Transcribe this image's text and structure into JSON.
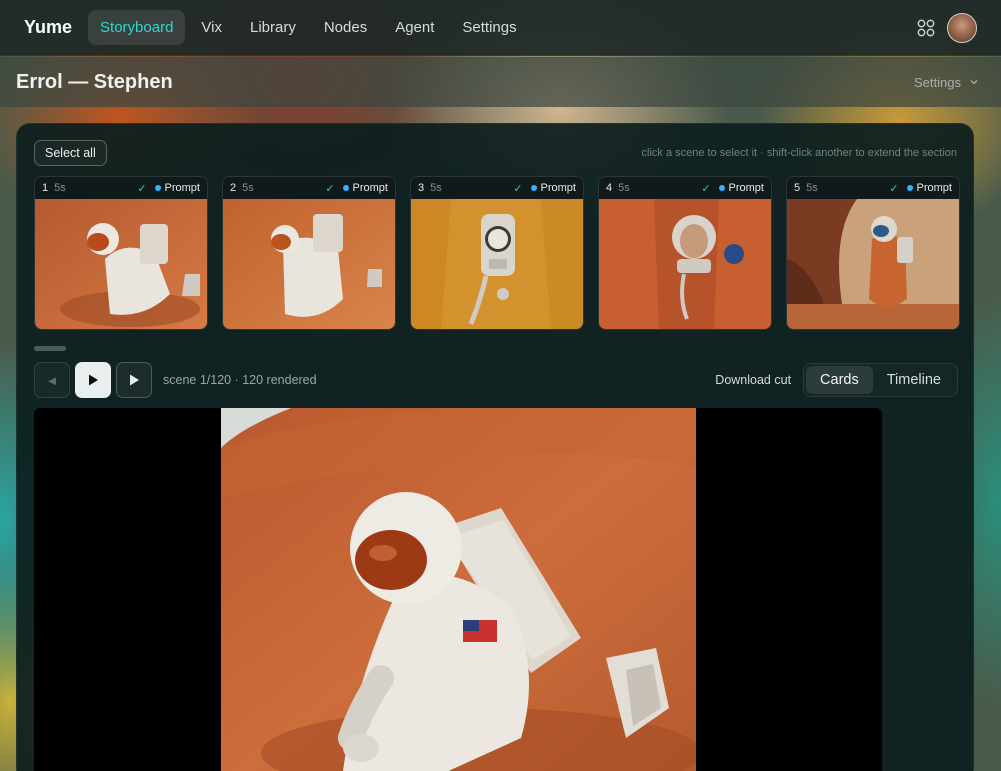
{
  "nav": {
    "brand": "Yume",
    "items": [
      {
        "label": "Storyboard",
        "active": true
      },
      {
        "label": "Vix",
        "active": false
      },
      {
        "label": "Library",
        "active": false
      },
      {
        "label": "Nodes",
        "active": false
      },
      {
        "label": "Agent",
        "active": false
      },
      {
        "label": "Settings",
        "active": false
      }
    ],
    "icons": [
      "apps-grid-icon",
      "user-avatar"
    ]
  },
  "subheader": {
    "title": "Errol — Stephen",
    "settings_label": "Settings"
  },
  "storyboard": {
    "select_all_label": "Select all",
    "hint": "click a scene to select it · shift-click another to extend the section",
    "scenes": [
      {
        "number": "1",
        "duration": "5s",
        "check": "✓",
        "prompt_label": "Prompt",
        "image": "astronaut-kneeling-in-sand"
      },
      {
        "number": "2",
        "duration": "5s",
        "check": "✓",
        "prompt_label": "Prompt",
        "image": "astronaut-sliding-down-dune"
      },
      {
        "number": "3",
        "duration": "5s",
        "check": "✓",
        "prompt_label": "Prompt",
        "image": "suit-pressure-gauge-closeup"
      },
      {
        "number": "4",
        "duration": "5s",
        "check": "✓",
        "prompt_label": "Prompt",
        "image": "astronaut-portrait-orange-suit"
      },
      {
        "number": "5",
        "duration": "5s",
        "check": "✓",
        "prompt_label": "Prompt",
        "image": "astronaut-by-rock-arch"
      }
    ]
  },
  "player": {
    "prev_icon": "◄",
    "status": "scene 1/120 · 120 rendered",
    "download_label": "Download cut",
    "view_modes": [
      {
        "label": "Cards",
        "active": true
      },
      {
        "label": "Timeline",
        "active": false
      }
    ]
  },
  "colors": {
    "accent": "#2fd6d0",
    "check": "#3bd08e",
    "prompt_dot": "#2fb3ff",
    "mars_sand": "#c8643a"
  }
}
